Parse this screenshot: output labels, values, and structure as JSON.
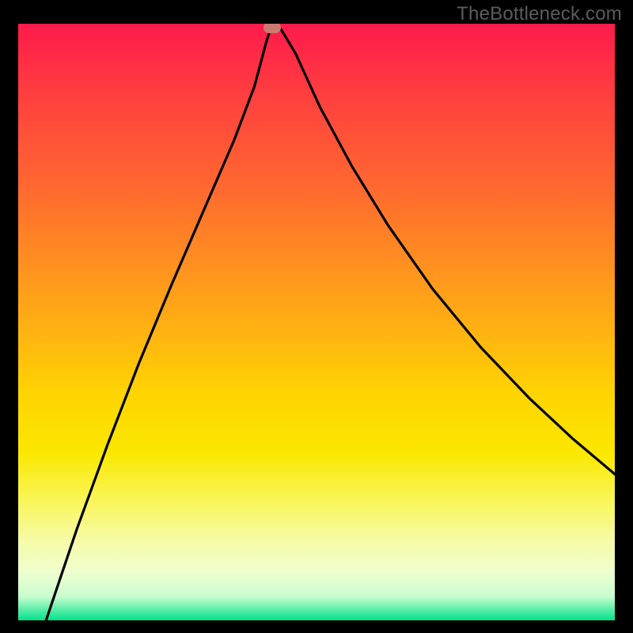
{
  "watermark": "TheBottleneck.com",
  "chart_data": {
    "type": "line",
    "title": "",
    "xlabel": "",
    "ylabel": "",
    "x_range_fraction": [
      0,
      1
    ],
    "y_range_fraction": [
      0,
      1
    ],
    "series": [
      {
        "name": "curve",
        "points_plot_fraction": [
          {
            "x": 0.0467,
            "y": 0.0
          },
          {
            "x": 0.098,
            "y": 0.152
          },
          {
            "x": 0.15,
            "y": 0.295
          },
          {
            "x": 0.202,
            "y": 0.43
          },
          {
            "x": 0.256,
            "y": 0.56
          },
          {
            "x": 0.31,
            "y": 0.685
          },
          {
            "x": 0.362,
            "y": 0.805
          },
          {
            "x": 0.396,
            "y": 0.895
          },
          {
            "x": 0.416,
            "y": 0.97
          },
          {
            "x": 0.426,
            "y": 1.0
          },
          {
            "x": 0.441,
            "y": 0.99
          },
          {
            "x": 0.465,
            "y": 0.95
          },
          {
            "x": 0.506,
            "y": 0.86
          },
          {
            "x": 0.56,
            "y": 0.76
          },
          {
            "x": 0.62,
            "y": 0.662
          },
          {
            "x": 0.695,
            "y": 0.555
          },
          {
            "x": 0.775,
            "y": 0.458
          },
          {
            "x": 0.857,
            "y": 0.372
          },
          {
            "x": 0.93,
            "y": 0.304
          },
          {
            "x": 1.0,
            "y": 0.245
          }
        ]
      }
    ],
    "marker": {
      "x_fraction": 0.426,
      "y_fraction": 0.993,
      "color": "#cc7a70"
    },
    "background_gradient": {
      "direction": "top-to-bottom",
      "stops": [
        {
          "pos": 0.0,
          "color": "#ff1a4b"
        },
        {
          "pos": 0.5,
          "color": "#ffc40a"
        },
        {
          "pos": 0.8,
          "color": "#f9f65a"
        },
        {
          "pos": 1.0,
          "color": "#00e289"
        }
      ]
    }
  }
}
